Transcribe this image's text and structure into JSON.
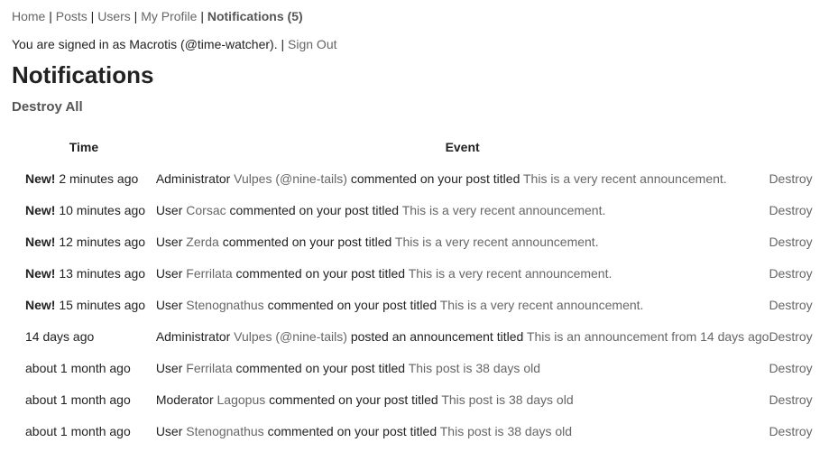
{
  "nav": {
    "home": "Home",
    "posts": "Posts",
    "users": "Users",
    "profile": "My Profile",
    "notifications": "Notifications (5)",
    "separator": " | "
  },
  "session": {
    "prefix": "You are signed in as Macrotis (@time-watcher). | ",
    "sign_out": "Sign Out"
  },
  "page_title": "Notifications",
  "destroy_all_label": "Destroy All",
  "table": {
    "headers": {
      "time": "Time",
      "event": "Event"
    },
    "new_label": "New!",
    "rows": [
      {
        "is_new": true,
        "time": "2 minutes ago",
        "role": "Administrator",
        "user": "Vulpes (@nine-tails)",
        "action": "commented on your post titled",
        "title": "This is a very recent announcement.",
        "destroy": "Destroy"
      },
      {
        "is_new": true,
        "time": "10 minutes ago",
        "role": "User",
        "user": "Corsac",
        "action": "commented on your post titled",
        "title": "This is a very recent announcement.",
        "destroy": "Destroy"
      },
      {
        "is_new": true,
        "time": "12 minutes ago",
        "role": "User",
        "user": "Zerda",
        "action": "commented on your post titled",
        "title": "This is a very recent announcement.",
        "destroy": "Destroy"
      },
      {
        "is_new": true,
        "time": "13 minutes ago",
        "role": "User",
        "user": "Ferrilata",
        "action": "commented on your post titled",
        "title": "This is a very recent announcement.",
        "destroy": "Destroy"
      },
      {
        "is_new": true,
        "time": "15 minutes ago",
        "role": "User",
        "user": "Stenognathus",
        "action": "commented on your post titled",
        "title": "This is a very recent announcement.",
        "destroy": "Destroy"
      },
      {
        "is_new": false,
        "time": "14 days ago",
        "role": "Administrator",
        "user": "Vulpes (@nine-tails)",
        "action": "posted an announcement titled",
        "title": "This is an announcement from 14 days ago",
        "destroy": "Destroy"
      },
      {
        "is_new": false,
        "time": "about 1 month ago",
        "role": "User",
        "user": "Ferrilata",
        "action": "commented on your post titled",
        "title": "This post is 38 days old",
        "destroy": "Destroy"
      },
      {
        "is_new": false,
        "time": "about 1 month ago",
        "role": "Moderator",
        "user": "Lagopus",
        "action": "commented on your post titled",
        "title": "This post is 38 days old",
        "destroy": "Destroy"
      },
      {
        "is_new": false,
        "time": "about 1 month ago",
        "role": "User",
        "user": "Stenognathus",
        "action": "commented on your post titled",
        "title": "This post is 38 days old",
        "destroy": "Destroy"
      }
    ]
  }
}
